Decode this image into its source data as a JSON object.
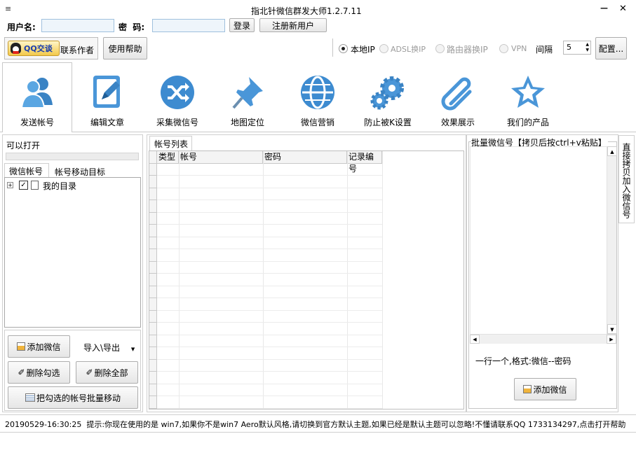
{
  "window": {
    "title": "指北针微信群发大师1.2.7.11",
    "menu_glyph": "≡",
    "minimize_glyph": "—",
    "close_glyph": "✕"
  },
  "login": {
    "username_label": "用户名:",
    "password_label": "密  码:",
    "username_value": "",
    "password_value": "",
    "login_button": "登录",
    "register_button": "注册新用户"
  },
  "actions": {
    "qq_button": "QQ交谈",
    "contact_author": "联系作者",
    "help_button": "使用帮助"
  },
  "ip_options": {
    "selected": "本地IP",
    "items": [
      "本地IP",
      "ADSL换IP",
      "路由器换IP",
      "VPN"
    ],
    "interval_label": "间隔",
    "interval_value": "5",
    "config_button": "配置..."
  },
  "toolbar": {
    "items": [
      "发送帐号",
      "编辑文章",
      "采集微信号",
      "地图定位",
      "微信营销",
      "防止被K设置",
      "效果展示",
      "我们的产品"
    ],
    "active": "发送帐号"
  },
  "left_panel": {
    "can_open_label": "可以打开",
    "tabs": [
      "微信帐号",
      "帐号移动目标"
    ],
    "tree_root": "我的目录",
    "add_wechat": "添加微信",
    "import_export": "导入\\导出",
    "delete_checked": "删除勾选",
    "delete_all": "删除全部",
    "batch_move": "把勾选的帐号批量移动"
  },
  "account_list": {
    "tab": "帐号列表",
    "columns": [
      "类型",
      "帐号",
      "密码",
      "记录编号"
    ]
  },
  "batch_panel": {
    "group_title": "批量微信号【拷贝后按ctrl+v粘贴】",
    "hint": "一行一个,格式:微信--密码",
    "add_button": "添加微信",
    "side_tab": "直接拷贝加入微信号"
  },
  "status_bar": {
    "message": "20190529-16:30:25  提示:你现在使用的是 win7,如果你不是win7 Aero默认风格,请切换到官方默认主题,如果已经是默认主题可以忽略!不懂请联系QQ 1733134297,点击打开帮助"
  }
}
